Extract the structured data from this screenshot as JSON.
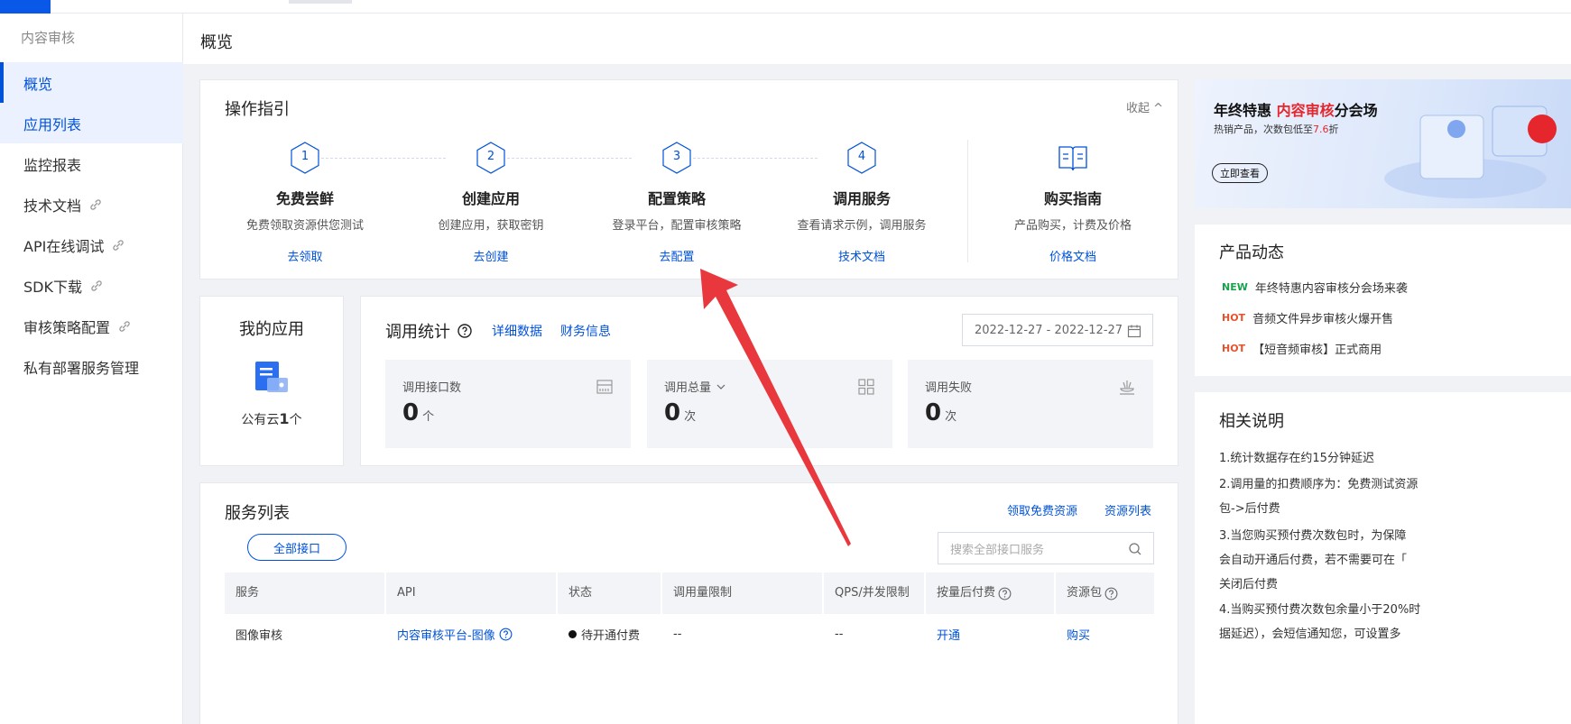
{
  "sidebar": {
    "title": "内容审核",
    "items": [
      {
        "label": "概览"
      },
      {
        "label": "应用列表"
      },
      {
        "label": "监控报表"
      },
      {
        "label": "技术文档"
      },
      {
        "label": "API在线调试"
      },
      {
        "label": "SDK下载"
      },
      {
        "label": "审核策略配置"
      },
      {
        "label": "私有部署服务管理"
      }
    ]
  },
  "header": {
    "title": "概览"
  },
  "guide": {
    "title": "操作指引",
    "collapse_label": "收起",
    "steps": [
      {
        "num": "1",
        "title": "免费尝鲜",
        "desc": "免费领取资源供您测试",
        "link": "去领取"
      },
      {
        "num": "2",
        "title": "创建应用",
        "desc": "创建应用，获取密钥",
        "link": "去创建"
      },
      {
        "num": "3",
        "title": "配置策略",
        "desc": "登录平台，配置审核策略",
        "link": "去配置"
      },
      {
        "num": "4",
        "title": "调用服务",
        "desc": "查看请求示例，调用服务",
        "link": "技术文档"
      }
    ],
    "buy": {
      "title": "购买指南",
      "desc": "产品购买，计费及价格",
      "link": "价格文档"
    }
  },
  "myapp": {
    "title": "我的应用",
    "count_prefix": "公有云",
    "count": "1",
    "count_suffix": "个"
  },
  "stats": {
    "title": "调用统计",
    "detail_link": "详细数据",
    "finance_link": "财务信息",
    "date_range": "2022-12-27 - 2022-12-27",
    "boxes": [
      {
        "label": "调用接口数",
        "value": "0",
        "unit": "个"
      },
      {
        "label": "调用总量",
        "value": "0",
        "unit": "次"
      },
      {
        "label": "调用失败",
        "value": "0",
        "unit": "次"
      }
    ]
  },
  "services": {
    "title": "服务列表",
    "free_link": "领取免费资源",
    "pkg_link": "资源列表",
    "filter_pill": "全部接口",
    "search_placeholder": "搜索全部接口服务",
    "columns": [
      "服务",
      "API",
      "状态",
      "调用量限制",
      "QPS/并发限制",
      "按量后付费",
      "资源包"
    ],
    "rows": [
      {
        "service": "图像审核",
        "api": "内容审核平台-图像",
        "status": "待开通付费",
        "limit": "--",
        "qps": "--",
        "postpaid": "开通",
        "package": "购买"
      }
    ]
  },
  "banner": {
    "title_prefix": "年终特惠 ",
    "title_highlight": "内容审核",
    "title_suffix": "分会场",
    "sub_prefix": "热销产品，次数包低至",
    "sub_highlight": "7.6",
    "sub_suffix": "折",
    "button": "立即查看"
  },
  "news": {
    "title": "产品动态",
    "items": [
      {
        "tag": "NEW",
        "text": "年终特惠内容审核分会场来袭"
      },
      {
        "tag": "HOT",
        "text": "音频文件异步审核火爆开售"
      },
      {
        "tag": "HOT",
        "text": "【短音频审核】正式商用"
      }
    ]
  },
  "notes": {
    "title": "相关说明",
    "lines": [
      "1.统计数据存在约15分钟延迟",
      "2.调用量的扣费顺序为：免费测试资源",
      "包->后付费",
      "3.当您购买预付费次数包时，为保障",
      "会自动开通后付费，若不需要可在「",
      "关闭后付费",
      "4.当购买预付费次数包余量小于20%时",
      "据延迟），会短信通知您，可设置多"
    ]
  },
  "colors": {
    "primary": "#0052d9",
    "annotation_arrow": "#e8383d",
    "tag_new": "#1aa24b",
    "tag_hot": "#e5532d"
  }
}
